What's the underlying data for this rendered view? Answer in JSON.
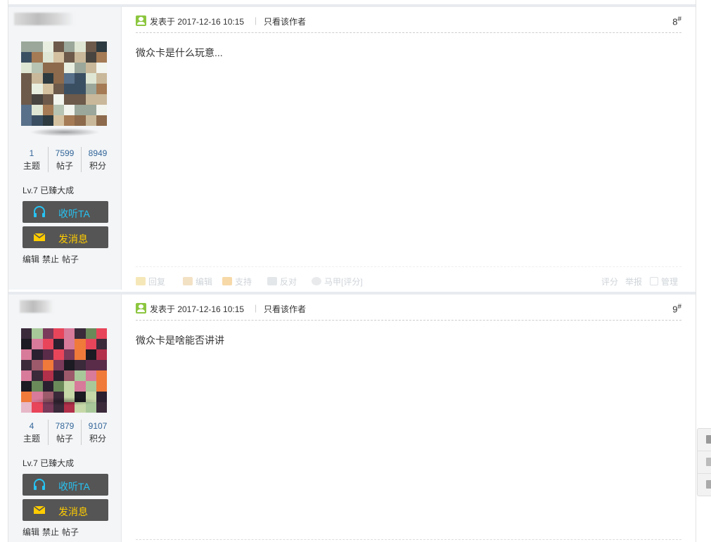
{
  "posts": [
    {
      "stats": [
        {
          "num": "1",
          "label": "主题"
        },
        {
          "num": "7599",
          "label": "帖子"
        },
        {
          "num": "8949",
          "label": "积分"
        }
      ],
      "level": "Lv.7 已臻大成",
      "follow_label": "收听TA",
      "message_label": "发消息",
      "admin": [
        "编辑",
        "禁止",
        "帖子"
      ],
      "posted": "发表于 2017-12-16 10:15",
      "only_author": "只看该作者",
      "floor": "8",
      "floor_mark": "#",
      "content": "微众卡是什么玩意...",
      "actions": {
        "reply": "回复",
        "edit": "编辑",
        "support": "支持",
        "oppose": "反对",
        "vest": "马甲[评分]",
        "rate": "评分",
        "report": "举报",
        "manage": "管理"
      }
    },
    {
      "stats": [
        {
          "num": "4",
          "label": "主题"
        },
        {
          "num": "7879",
          "label": "帖子"
        },
        {
          "num": "9107",
          "label": "积分"
        }
      ],
      "level": "Lv.7 已臻大成",
      "follow_label": "收听TA",
      "message_label": "发消息",
      "admin": [
        "编辑",
        "禁止",
        "帖子"
      ],
      "posted": "发表于 2017-12-16 10:15",
      "only_author": "只看该作者",
      "floor": "9",
      "floor_mark": "#",
      "content": "微众卡是啥能否讲讲"
    }
  ],
  "colors": {
    "accent_stat": "#336699",
    "follow_text": "#27c3f2",
    "message_text": "#ffcc00",
    "button_bg": "#555555",
    "user_icon": "#8cc63f"
  },
  "icons": [
    "user-icon",
    "headphones-icon",
    "envelope-icon",
    "reply-icon",
    "pencil-icon",
    "thumb-up-icon",
    "thumb-down-icon",
    "mask-icon"
  ]
}
